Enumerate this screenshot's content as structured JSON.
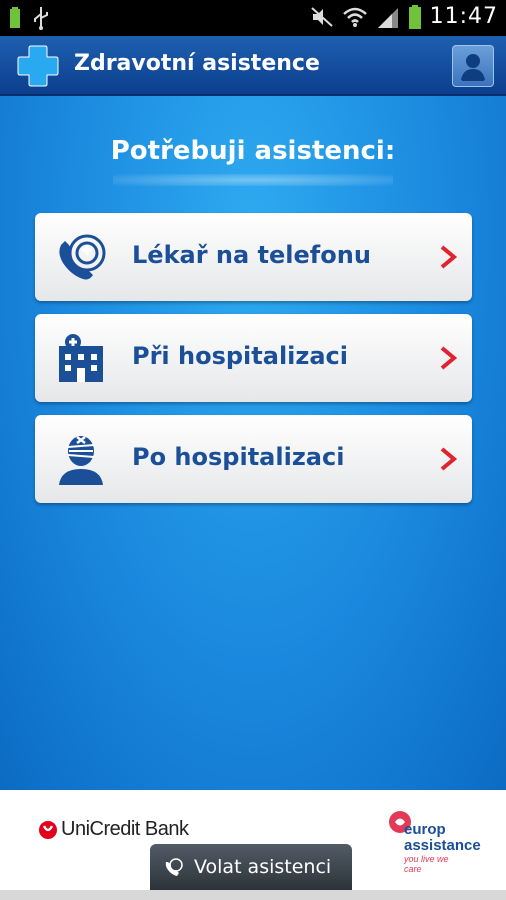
{
  "statusbar": {
    "time": "11:47",
    "icons": [
      "battery-charging-icon",
      "usb-icon",
      "mute-icon",
      "wifi-icon",
      "signal-icon",
      "battery-icon"
    ]
  },
  "appbar": {
    "title": "Zdravotní asistence",
    "logo_icon": "medical-cross-icon",
    "profile_icon": "profile-icon"
  },
  "main": {
    "headline": "Potřebuji asistenci:",
    "items": [
      {
        "label": "Lékař na telefonu",
        "icon": "doctor-phone-icon"
      },
      {
        "label": "Při hospitalizaci",
        "icon": "hospital-icon"
      },
      {
        "label": "Po hospitalizaci",
        "icon": "patient-bandage-icon"
      }
    ]
  },
  "footer": {
    "unicredit_logo": "UniCredit Bank",
    "europ_logo": "europ assistance",
    "europ_tagline": "you live we care",
    "call_button": "Volat asistenci"
  },
  "colors": {
    "accent": "#1b4f97",
    "chevron": "#e0232c",
    "background": "#1a88de"
  }
}
